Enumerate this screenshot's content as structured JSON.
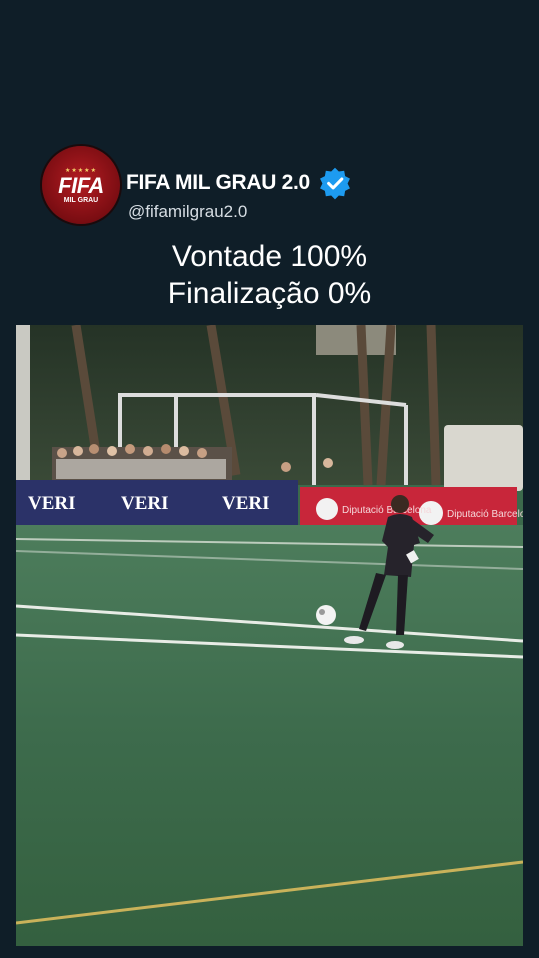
{
  "profile": {
    "avatar_logo": "FIFA",
    "avatar_sub": "MIL GRAU",
    "avatar_stars": "★★★★★",
    "display_name": "FIFA MIL GRAU 2.0",
    "handle": "@fifamilgrau2.0",
    "verified_icon": "verified-badge-icon"
  },
  "caption": {
    "line1": "Vontade 100%",
    "line2": "Finalização 0%"
  },
  "video": {
    "banner_left": [
      "VERI",
      "VERI",
      "VERI"
    ],
    "banner_right": [
      "Diputació Barcelona",
      "Diputació Barcelona"
    ]
  },
  "colors": {
    "background": "#0f1e28",
    "verified": "#1d9bf0",
    "pitch": "#3f6f4f",
    "banner_blue": "#2b3268",
    "banner_red": "#c8263a"
  }
}
